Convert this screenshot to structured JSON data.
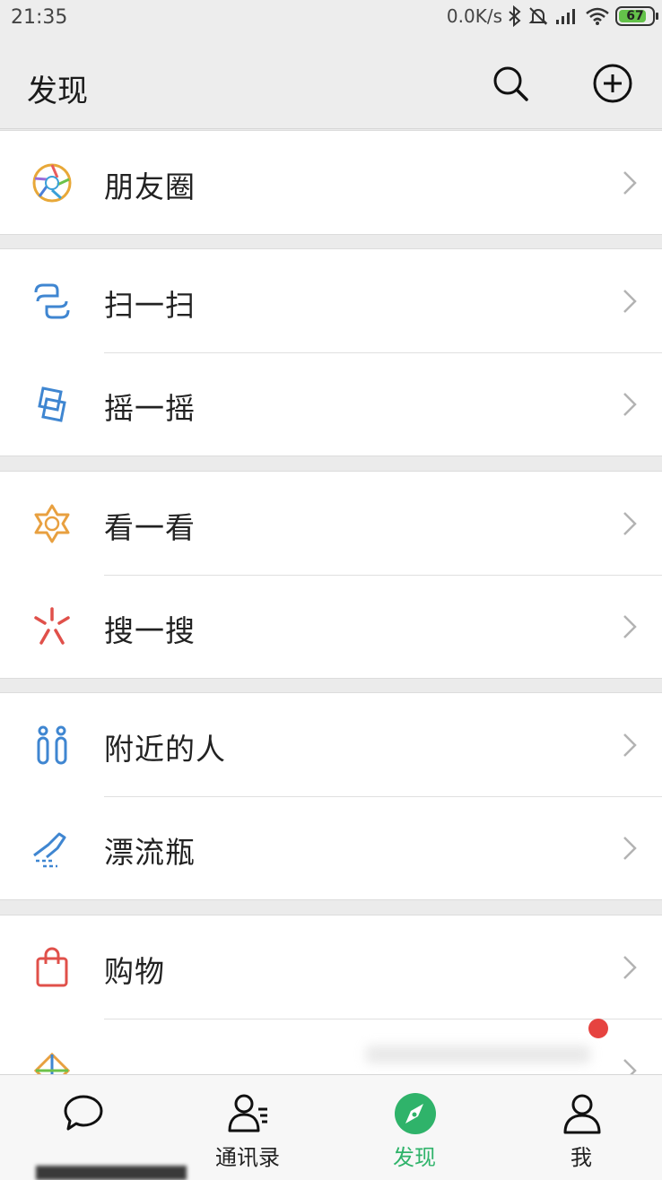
{
  "status_bar": {
    "time": "21:35",
    "network_speed": "0.0K/s",
    "battery": "67"
  },
  "header": {
    "title": "发现"
  },
  "groups": [
    {
      "items": [
        {
          "label": "朋友圈",
          "icon": "moments-icon"
        }
      ]
    },
    {
      "items": [
        {
          "label": "扫一扫",
          "icon": "scan-icon"
        },
        {
          "label": "摇一摇",
          "icon": "shake-icon"
        }
      ]
    },
    {
      "items": [
        {
          "label": "看一看",
          "icon": "top-stories-icon"
        },
        {
          "label": "搜一搜",
          "icon": "search-feature-icon"
        }
      ]
    },
    {
      "items": [
        {
          "label": "附近的人",
          "icon": "people-nearby-icon"
        },
        {
          "label": "漂流瓶",
          "icon": "drift-bottle-icon"
        }
      ]
    },
    {
      "items": [
        {
          "label": "购物",
          "icon": "shopping-icon"
        },
        {
          "label": "",
          "icon": "games-icon"
        }
      ]
    }
  ],
  "bottom_nav": [
    {
      "label": "",
      "icon": "chat-icon",
      "active": false
    },
    {
      "label": "通讯录",
      "icon": "contacts-icon",
      "active": false
    },
    {
      "label": "发现",
      "icon": "discover-compass-icon",
      "active": true
    },
    {
      "label": "我",
      "icon": "me-icon",
      "active": false
    }
  ],
  "colors": {
    "accent_green": "#2fb36a",
    "badge_red": "#e64340",
    "background": "#ebebeb"
  }
}
